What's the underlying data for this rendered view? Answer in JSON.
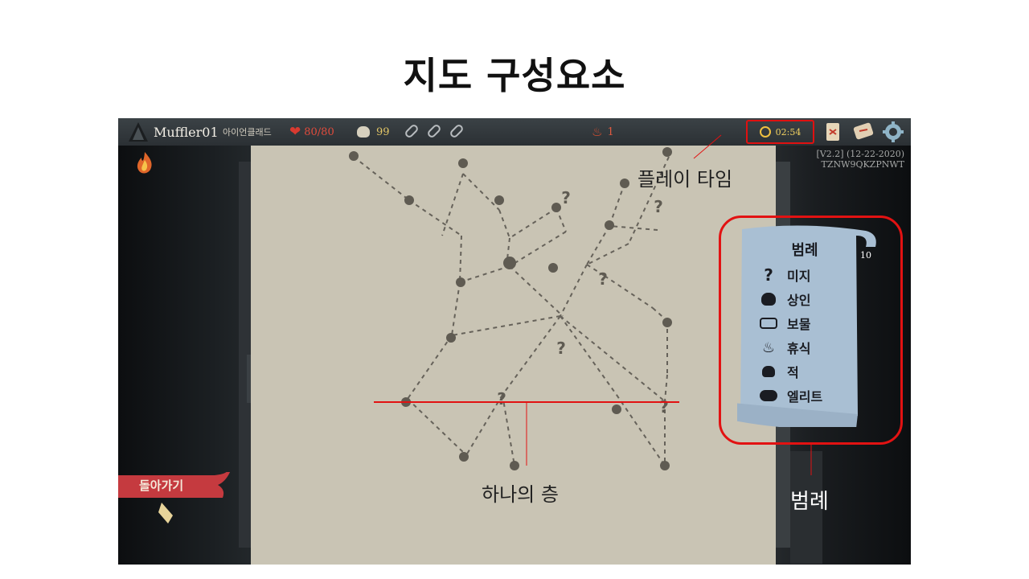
{
  "slide": {
    "title": "지도 구성요소"
  },
  "topbar": {
    "player_name": "Muffler01",
    "character_class": "아이언클래드",
    "hp": "80/80",
    "gold": "99",
    "ascension": "1",
    "play_time": "02:54",
    "deck_count": "10"
  },
  "version": {
    "line1": "[V2.2] (12-22-2020)",
    "line2": "TZNW9QKZPNWT"
  },
  "legend": {
    "title": "범례",
    "items": [
      {
        "icon": "question-icon",
        "label": "미지"
      },
      {
        "icon": "merchant-bag-icon",
        "label": "상인"
      },
      {
        "icon": "treasure-chest-icon",
        "label": "보물"
      },
      {
        "icon": "campfire-icon",
        "label": "휴식"
      },
      {
        "icon": "enemy-skull-icon",
        "label": "적"
      },
      {
        "icon": "elite-horned-icon",
        "label": "엘리트"
      }
    ]
  },
  "buttons": {
    "back": "돌아가기"
  },
  "annotations": {
    "play_time": "플레이 타임",
    "floor": "하나의 층",
    "legend": "범례"
  },
  "colors": {
    "highlight": "#e21212",
    "map_paper": "#c9c4b4",
    "legend_paper": "#a9bfd3"
  }
}
